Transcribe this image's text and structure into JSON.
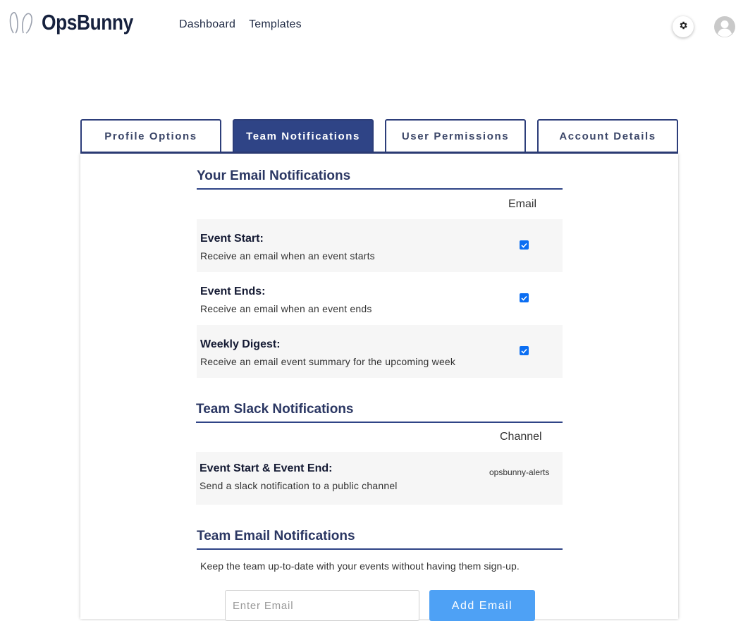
{
  "header": {
    "brand": "OpsBunny",
    "nav": [
      "Dashboard",
      "Templates"
    ],
    "icons": [
      "bunny-ears-logo-icon",
      "gear-icon",
      "user-avatar-icon"
    ]
  },
  "tabs": [
    {
      "label": "Profile Options",
      "active": false
    },
    {
      "label": "Team Notifications",
      "active": true
    },
    {
      "label": "User Permissions",
      "active": false
    },
    {
      "label": "Account Details",
      "active": false
    }
  ],
  "email_notifications": {
    "title": "Your Email Notifications",
    "column": "Email",
    "rows": [
      {
        "title": "Event Start:",
        "desc": "Receive an email when an event starts",
        "checked": true
      },
      {
        "title": "Event Ends:",
        "desc": "Receive an email when an event ends",
        "checked": true
      },
      {
        "title": "Weekly Digest:",
        "desc": "Receive an email event summary for the upcoming week",
        "checked": true
      }
    ]
  },
  "slack_notifications": {
    "title": "Team Slack Notifications",
    "column": "Channel",
    "rows": [
      {
        "title": "Event Start & Event End:",
        "desc": "Send a slack notification to a public channel",
        "channel": "opsbunny-alerts"
      }
    ]
  },
  "team_email": {
    "title": "Team Email Notifications",
    "helper": "Keep the team up-to-date with your events without having them sign-up.",
    "input_placeholder": "Enter Email",
    "add_button": "Add Email"
  },
  "colors": {
    "primary": "#2f4486",
    "checkbox": "#0b6ef2",
    "add_button": "#4ea1f5",
    "row_shade": "#f6f6f6"
  }
}
